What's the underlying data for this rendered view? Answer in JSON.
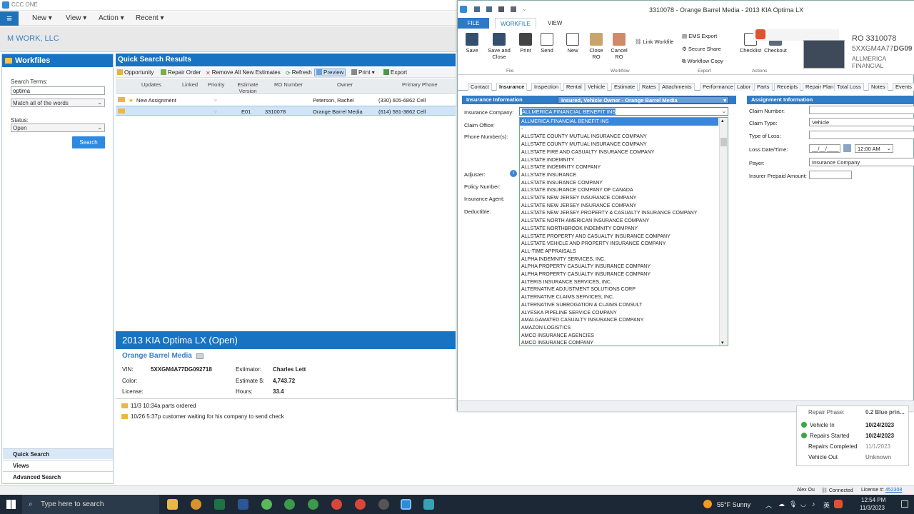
{
  "app": {
    "title": "CCC ONE",
    "company": "M WORK, LLC"
  },
  "menu": {
    "new": "New ▾",
    "view": "View ▾",
    "action": "Action ▾",
    "recent": "Recent ▾"
  },
  "workfiles": {
    "title": "Workfiles",
    "search_terms_label": "Search Terms:",
    "search_value": "optima",
    "match_value": "Match all of the words",
    "status_label": "Status:",
    "status_value": "Open",
    "search_button": "Search"
  },
  "nav": [
    "Quick Search",
    "Views",
    "Advanced Search"
  ],
  "qsr": {
    "title": "Quick Search Results",
    "toolbar": [
      "Opportunity",
      "Repair Order",
      "Remove All New Estimates",
      "Refresh",
      "Preview",
      "Print",
      "Export"
    ],
    "columns": [
      "Updates",
      "Linked",
      "Priority",
      "Estimate Version",
      "RO Number",
      "Owner",
      "Primary Phone"
    ],
    "rows": [
      {
        "update": "New Assignment",
        "version": "",
        "ro": "",
        "owner": "Peterson, Rachel",
        "phone": "(330) 605-6862 Cell"
      },
      {
        "update": "",
        "version": "E01",
        "ro": "3310078",
        "owner": "Orange Barrel Media",
        "phone": "(614) 581-3862 Cell"
      }
    ]
  },
  "detail": {
    "title": "2013 KIA Optima LX (Open)",
    "owner": "Orange Barrel Media",
    "vin_label": "VIN:",
    "vin": "5XXGM4A77DG092718",
    "color_label": "Color:",
    "license_label": "License:",
    "estimator_label": "Estimator:",
    "estimator": "Charles Lett",
    "estimate_label": "Estimate $:",
    "estimate": "4,743.72",
    "hours_label": "Hours:",
    "hours": "33.4",
    "notes": [
      "11/3 10:34a parts ordered",
      "10/26 5:37p customer waiting for his company to send check"
    ]
  },
  "modal": {
    "title": "3310078 - Orange Barrel Media - 2013 KIA Optima LX",
    "tabs": [
      "FILE",
      "WORKFILE",
      "VIEW"
    ],
    "ribbon": [
      "Save",
      "Save and Close",
      "Print",
      "Send",
      "New",
      "Close RO",
      "Cancel RO",
      "Link Workfile",
      "EMS Export",
      "Secure Share",
      "Workflow Copy",
      "Checklist",
      "Checkout"
    ],
    "groups": [
      "File",
      "Workflow",
      "Export",
      "Actions"
    ],
    "ro": "RO 3310078",
    "vin_short": "5XXGM4A77",
    "vin_bold": "DG09",
    "ins_short": "ALLMERICA FINANCIAL",
    "subtabs": [
      "Contact",
      "Insurance",
      "Inspection",
      "Rental",
      "Vehicle",
      "Estimate",
      "Rates",
      "Attachments",
      "Performance",
      "Labor",
      "Parts",
      "Receipts",
      "Repair Plan",
      "Total Loss",
      "Notes",
      "Events"
    ],
    "ins_section": "Insurance Information",
    "ins_dropdown": "Insured, Vehicle Owner - Orange Barrel Media",
    "fields": [
      "Insurance Company:",
      "Claim Office:",
      "Phone Number(s):",
      "Adjuster:",
      "Policy Number:",
      "Insurance Agent:",
      "Deductible:"
    ],
    "ins_company": "ALLMERICA FINANCIAL BENEFIT INS",
    "assign_section": "Assignment Information",
    "assign_fields": [
      "Claim Number:",
      "Claim Type:",
      "Type of Loss:",
      "Loss Date/Time:",
      "Payer:",
      "Insurer Prepaid Amount:"
    ],
    "claim_type": "Vehicle",
    "loss_date": "__/__/____",
    "loss_time": "12:00 AM",
    "payer": "Insurance Company",
    "options": [
      "ALLMERICA FINANCIAL BENEFIT INS",
      "-",
      "ALLSTATE COUNTY MUTUAL INSURANCE COMPANY",
      "ALLSTATE COUNTY MUTUAL INSURANCE COMPANY",
      "ALLSTATE FIRE AND CASUALTY INSURANCE COMPANY",
      "ALLSTATE INDEMNITY",
      "ALLSTATE INDEMNITY COMPANY",
      "ALLSTATE INSURANCE",
      "ALLSTATE INSURANCE COMPANY",
      "ALLSTATE INSURANCE COMPANY OF CANADA",
      "ALLSTATE NEW JERSEY INSURANCE COMPANY",
      "ALLSTATE NEW JERSEY INSURANCE COMPANY",
      "ALLSTATE NEW JERSEY PROPERTY & CASUALTY INSURANCE  COMPANY",
      "ALLSTATE NORTH AMERICAN INSURANCE COMPANY",
      "ALLSTATE NORTHBROOK INDEMNITY COMPANY",
      "ALLSTATE PROPERTY AND CASUALTY INSURANCE COMPANY",
      "ALLSTATE VEHICLE AND  PROPERTY INSURANCE COMPANY",
      "ALL-TIME APPRAISALS",
      "ALPHA INDEMNITY SERVICES, INC.",
      "ALPHA PROPERTY CASUALTY INSURANCE COMPANY",
      "ALPHA PROPERTY CASUALTY INSURANCE COMPANY",
      "ALTERIS INSURANCE SERVICES, INC.",
      "ALTERNATIVE ADJUSTMENT SOLUTIONS CORP",
      "ALTERNATIVE CLAIMS SERVICES, INC.",
      "ALTERNATIVE SUBROGATION & CLAIMS CONSULT",
      "ALYESKA PIPELINE SERVICE COMPANY",
      "AMALGAMATED CASUALTY INSURANCE COMPANY",
      "AMAZON LOGISTICS",
      "AMCO INSURANCE AGENCIES",
      "AMCO INSURANCE COMPANY"
    ]
  },
  "status": {
    "phase_label": "Repair Phase:",
    "phase": "0.2 Blue prin...",
    "items": [
      {
        "label": "Vehicle In",
        "value": "10/24/2023"
      },
      {
        "label": "Repairs Started",
        "value": "10/24/2023"
      },
      {
        "label": "Repairs Completed",
        "value": "11/1/2023"
      },
      {
        "label": "Vehicle Out",
        "value": "Unknown"
      }
    ]
  },
  "statusbar": {
    "user": "Alex Ou",
    "connected": "Connected",
    "license_label": "License #:",
    "license": "452308"
  },
  "taskbar": {
    "search": "Type here to search",
    "weather": "55°F  Sunny",
    "time": "12:54 PM",
    "date": "11/3/2023"
  }
}
